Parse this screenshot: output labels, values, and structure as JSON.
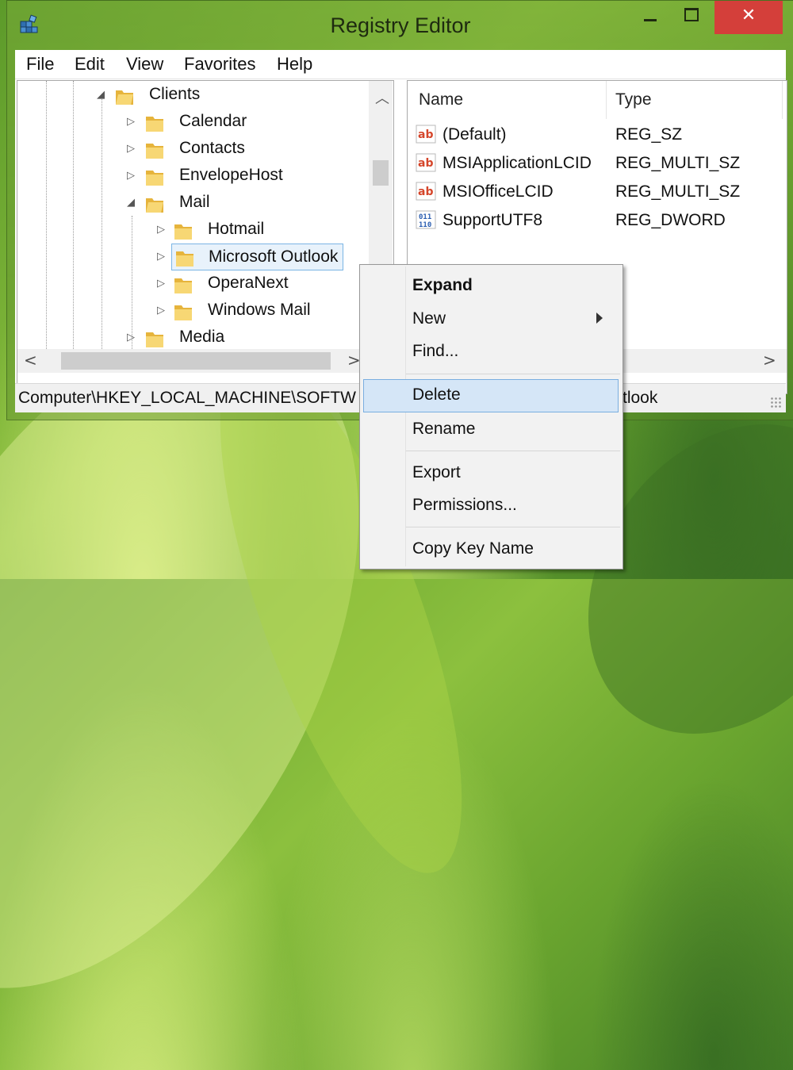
{
  "window": {
    "title": "Registry Editor",
    "close_glyph": "✕"
  },
  "menubar": [
    "File",
    "Edit",
    "View",
    "Favorites",
    "Help"
  ],
  "tree": {
    "nodes": [
      {
        "label": "Clients",
        "expanded": true
      },
      {
        "label": "Calendar",
        "expanded": false
      },
      {
        "label": "Contacts",
        "expanded": false
      },
      {
        "label": "EnvelopeHost",
        "expanded": false
      },
      {
        "label": "Mail",
        "expanded": true
      },
      {
        "label": "Hotmail",
        "expanded": false
      },
      {
        "label": "Microsoft Outlook",
        "expanded": false,
        "selected": true
      },
      {
        "label": "OperaNext",
        "expanded": false
      },
      {
        "label": "Windows Mail",
        "expanded": false
      },
      {
        "label": "Media",
        "expanded": false
      }
    ]
  },
  "values": {
    "columns": {
      "name": "Name",
      "type": "Type"
    },
    "rows": [
      {
        "name": "(Default)",
        "type": "REG_SZ",
        "icon": "string-value-icon"
      },
      {
        "name": "MSIApplicationLCID",
        "type": "REG_MULTI_SZ",
        "icon": "string-value-icon"
      },
      {
        "name": "MSIOfficeLCID",
        "type": "REG_MULTI_SZ",
        "icon": "string-value-icon"
      },
      {
        "name": "SupportUTF8",
        "type": "REG_DWORD",
        "icon": "binary-value-icon"
      }
    ]
  },
  "status": {
    "path_visible": "Computer\\HKEY_LOCAL_MACHINE\\SOFTW",
    "path_tail_visible": "tlook"
  },
  "context_menu": {
    "items": [
      {
        "label": "Expand",
        "bold": true
      },
      {
        "label": "New",
        "submenu": true
      },
      {
        "label": "Find..."
      },
      {
        "label": "Delete",
        "highlighted": true
      },
      {
        "label": "Rename"
      },
      {
        "label": "Export"
      },
      {
        "label": "Permissions..."
      },
      {
        "label": "Copy Key Name"
      }
    ]
  },
  "colors": {
    "selection_fill": "#e8f2fb",
    "selection_border": "#7bb5e4",
    "menu_highlight": "#d5e6f7",
    "close_button": "#d43f3a",
    "folder_yellow": "#f2c94c"
  }
}
